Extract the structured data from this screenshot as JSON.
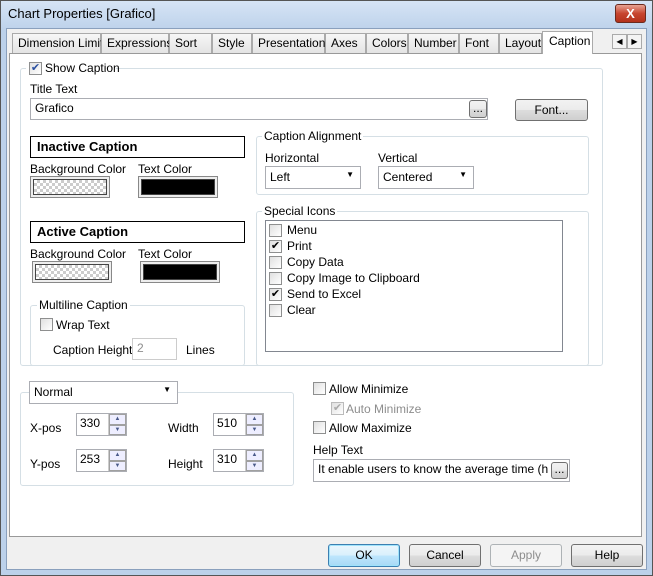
{
  "window": {
    "title": "Chart Properties [Grafico]",
    "close_label": "X"
  },
  "tabs": [
    "Dimension Limits",
    "Expressions",
    "Sort",
    "Style",
    "Presentation",
    "Axes",
    "Colors",
    "Number",
    "Font",
    "Layout",
    "Caption"
  ],
  "active_tab": "Caption",
  "caption": {
    "show_caption_label": "Show Caption",
    "show_caption_checked": true,
    "title_text_label": "Title Text",
    "title_text_value": "Grafico",
    "ellipsis": "...",
    "font_button": "Font...",
    "inactive_caption": "Inactive Caption",
    "active_caption": "Active Caption",
    "background_color_label": "Background Color",
    "text_color_label": "Text Color",
    "text_color": "#000000",
    "multiline": {
      "group_label": "Multiline Caption",
      "wrap_text_label": "Wrap Text",
      "wrap_text_checked": false,
      "caption_height_label": "Caption Height",
      "caption_height_value": "2",
      "lines_label": "Lines"
    },
    "alignment": {
      "group_label": "Caption Alignment",
      "horizontal_label": "Horizontal",
      "horizontal_value": "Left",
      "vertical_label": "Vertical",
      "vertical_value": "Centered"
    },
    "special_icons": {
      "group_label": "Special Icons",
      "items": [
        {
          "label": "Menu",
          "checked": false
        },
        {
          "label": "Print",
          "checked": true
        },
        {
          "label": "Copy Data",
          "checked": false
        },
        {
          "label": "Copy Image to Clipboard",
          "checked": false
        },
        {
          "label": "Send to Excel",
          "checked": true
        },
        {
          "label": "Clear",
          "checked": false
        }
      ]
    }
  },
  "position": {
    "mode_value": "Normal",
    "xpos_label": "X-pos",
    "xpos_value": "330",
    "ypos_label": "Y-pos",
    "ypos_value": "253",
    "width_label": "Width",
    "width_value": "510",
    "height_label": "Height",
    "height_value": "310"
  },
  "options": {
    "allow_minimize_label": "Allow Minimize",
    "allow_minimize_checked": false,
    "auto_minimize_label": "Auto Minimize",
    "auto_minimize_checked": true,
    "allow_maximize_label": "Allow Maximize",
    "allow_maximize_checked": false,
    "help_text_label": "Help Text",
    "help_text_value": "It enable users to know the average time (h"
  },
  "buttons": {
    "ok": "OK",
    "cancel": "Cancel",
    "apply": "Apply",
    "help": "Help"
  }
}
